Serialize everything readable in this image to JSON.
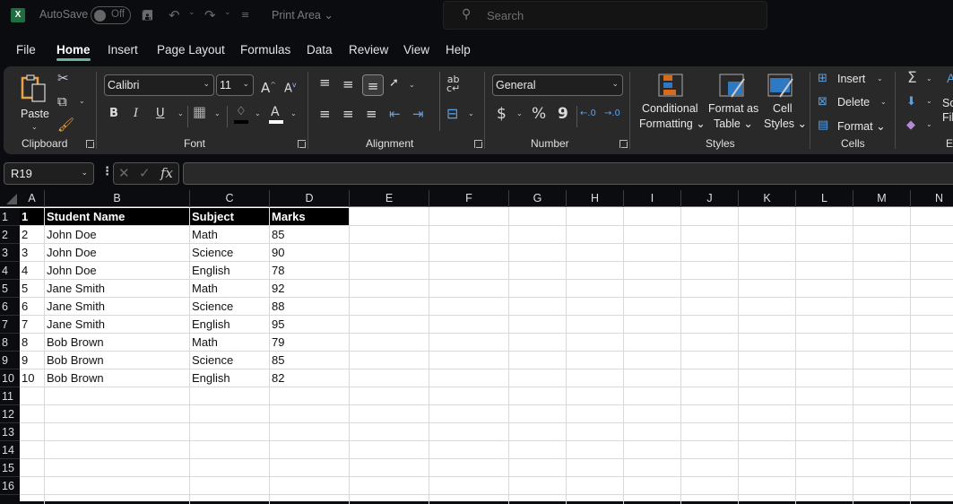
{
  "titlebar": {
    "app_icon": "excel-logo-icon",
    "app_icon_glyph": "X",
    "autosave_label": "AutoSave",
    "autosave_state": "Off",
    "print_area_label": "Print Area",
    "search_placeholder": "Search"
  },
  "tabs": [
    {
      "label": "File",
      "active": false
    },
    {
      "label": "Home",
      "active": true
    },
    {
      "label": "Insert",
      "active": false
    },
    {
      "label": "Page Layout",
      "active": false
    },
    {
      "label": "Formulas",
      "active": false
    },
    {
      "label": "Data",
      "active": false
    },
    {
      "label": "Review",
      "active": false
    },
    {
      "label": "View",
      "active": false
    },
    {
      "label": "Help",
      "active": false
    }
  ],
  "ribbon": {
    "clipboard": {
      "label": "Clipboard",
      "paste_label": "Paste"
    },
    "font": {
      "label": "Font",
      "font_name": "Calibri",
      "font_size": "11",
      "bold": "B",
      "italic": "I",
      "underline": "U"
    },
    "alignment": {
      "label": "Alignment"
    },
    "number": {
      "label": "Number",
      "format": "General",
      "currency": "$",
      "percent": "%",
      "comma": "9"
    },
    "styles": {
      "label": "Styles",
      "conditional_formatting": [
        "Conditional",
        "Formatting"
      ],
      "format_as_table": [
        "Format as",
        "Table"
      ],
      "cell_styles": [
        "Cell",
        "Styles"
      ]
    },
    "cells": {
      "label": "Cells",
      "insert": "Insert",
      "delete": "Delete",
      "format": "Format"
    },
    "editing": {
      "label_partial": "E",
      "sort_partial": [
        "So",
        "Fil"
      ]
    }
  },
  "formula_bar": {
    "name_box": "R19",
    "formula": "",
    "fx_label": "fx"
  },
  "sheet": {
    "columns": [
      "A",
      "B",
      "C",
      "D",
      "E",
      "F",
      "G",
      "H",
      "I",
      "J",
      "K",
      "L",
      "M",
      "N"
    ],
    "row_numbers": [
      "1",
      "2",
      "3",
      "4",
      "5",
      "6",
      "7",
      "8",
      "9",
      "10",
      "11",
      "12",
      "13",
      "14",
      "15",
      "16"
    ],
    "header_row": [
      "1",
      "Student Name",
      "Subject",
      "Marks"
    ],
    "rows": [
      [
        "2",
        "John Doe",
        "Math",
        "85"
      ],
      [
        "3",
        "John Doe",
        "Science",
        "90"
      ],
      [
        "4",
        "John Doe",
        "English",
        "78"
      ],
      [
        "5",
        "Jane Smith",
        "Math",
        "92"
      ],
      [
        "6",
        "Jane Smith",
        "Science",
        "88"
      ],
      [
        "7",
        "Jane Smith",
        "English",
        "95"
      ],
      [
        "8",
        "Bob Brown",
        "Math",
        "79"
      ],
      [
        "9",
        "Bob Brown",
        "Science",
        "85"
      ],
      [
        "10",
        "Bob Brown",
        "English",
        "82"
      ]
    ]
  },
  "colors": {
    "accent_tab_underline": "#6fb39a",
    "excel_green": "#1d6f42",
    "ribbon_bg": "#292929",
    "header_row_bg": "#000000"
  }
}
